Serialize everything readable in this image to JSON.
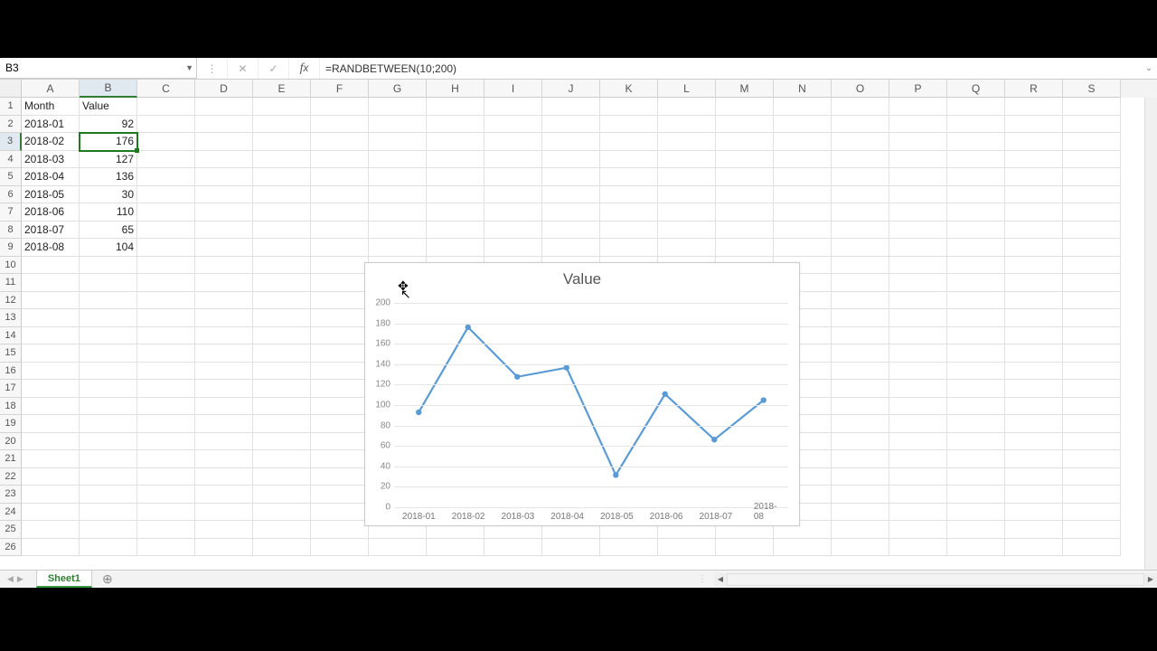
{
  "formula_bar": {
    "cell_ref": "B3",
    "formula": "=RANDBETWEEN(10;200)"
  },
  "columns": [
    "A",
    "B",
    "C",
    "D",
    "E",
    "F",
    "G",
    "H",
    "I",
    "J",
    "K",
    "L",
    "M",
    "N",
    "O",
    "P",
    "Q",
    "R",
    "S"
  ],
  "active_col_index": 1,
  "active_row_index": 2,
  "headers": {
    "A": "Month",
    "B": "Value"
  },
  "rows": [
    {
      "n": 1,
      "A": "Month",
      "B": "Value"
    },
    {
      "n": 2,
      "A": "2018-01",
      "B": "92"
    },
    {
      "n": 3,
      "A": "2018-02",
      "B": "176"
    },
    {
      "n": 4,
      "A": "2018-03",
      "B": "127"
    },
    {
      "n": 5,
      "A": "2018-04",
      "B": "136"
    },
    {
      "n": 6,
      "A": "2018-05",
      "B": "30"
    },
    {
      "n": 7,
      "A": "2018-06",
      "B": "110"
    },
    {
      "n": 8,
      "A": "2018-07",
      "B": "65"
    },
    {
      "n": 9,
      "A": "2018-08",
      "B": "104"
    },
    {
      "n": 10
    },
    {
      "n": 11
    },
    {
      "n": 12
    },
    {
      "n": 13
    },
    {
      "n": 14
    },
    {
      "n": 15
    },
    {
      "n": 16
    },
    {
      "n": 17
    },
    {
      "n": 18
    },
    {
      "n": 19
    },
    {
      "n": 20
    },
    {
      "n": 21
    },
    {
      "n": 22
    },
    {
      "n": 23
    },
    {
      "n": 24
    },
    {
      "n": 25
    },
    {
      "n": 26
    }
  ],
  "chart_data": {
    "type": "line",
    "title": "Value",
    "categories": [
      "2018-01",
      "2018-02",
      "2018-03",
      "2018-04",
      "2018-05",
      "2018-06",
      "2018-07",
      "2018-08"
    ],
    "values": [
      92,
      176,
      127,
      136,
      30,
      110,
      65,
      104
    ],
    "ylim": [
      0,
      200
    ],
    "yticks": [
      0,
      20,
      40,
      60,
      80,
      100,
      120,
      140,
      160,
      180,
      200
    ],
    "line_color": "#5B9BD5"
  },
  "sheet_tab": "Sheet1"
}
